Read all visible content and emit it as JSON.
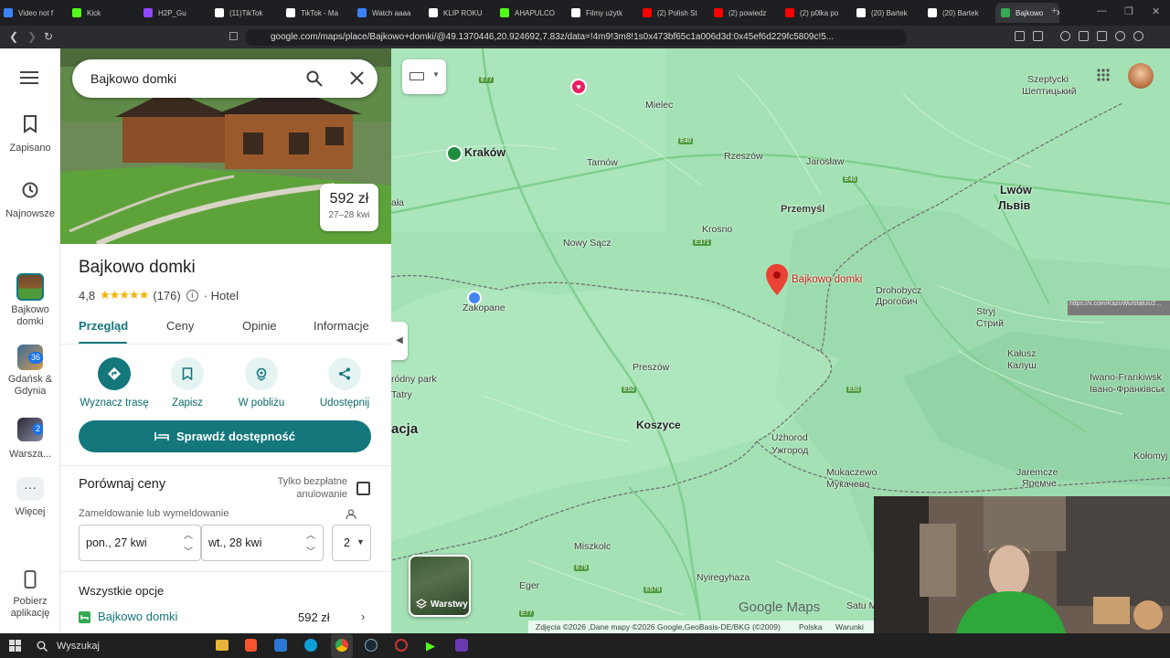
{
  "browser": {
    "tabs": [
      {
        "label": "Video not f",
        "icon": "video-icon",
        "color": "#3b82f6"
      },
      {
        "label": "Kick",
        "icon": "kick-icon",
        "color": "#53fc18"
      },
      {
        "label": "H2P_Gu",
        "icon": "twitch-icon",
        "color": "#9146ff"
      },
      {
        "label": "(11)TikTok",
        "icon": "tiktok-icon",
        "color": "#ffffff"
      },
      {
        "label": "TikTok - Ma",
        "icon": "tiktok-icon",
        "color": "#ffffff"
      },
      {
        "label": "Watch aaaa",
        "icon": "video-icon",
        "color": "#3b82f6"
      },
      {
        "label": "KLIP ROKU",
        "icon": "tiktok-icon",
        "color": "#ffffff"
      },
      {
        "label": "AHAPULCO",
        "icon": "kick-icon",
        "color": "#53fc18"
      },
      {
        "label": "Filmy użytk",
        "icon": "tiktok-icon",
        "color": "#ffffff"
      },
      {
        "label": "(2) Polish St",
        "icon": "youtube-icon",
        "color": "#ff0000"
      },
      {
        "label": "(2) powiedz",
        "icon": "youtube-icon",
        "color": "#ff0000"
      },
      {
        "label": "(2) p0lka po",
        "icon": "youtube-icon",
        "color": "#ff0000"
      },
      {
        "label": "(20) Bartek",
        "icon": "x-icon",
        "color": "#ffffff"
      },
      {
        "label": "(20) Bartek",
        "icon": "x-icon",
        "color": "#ffffff"
      },
      {
        "label": "Bajkowo",
        "icon": "maps-pin-icon",
        "color": "#34a853",
        "active": true
      }
    ],
    "url": "google.com/maps/place/Bajkowo+domki/@49.1370446,20.924692,7.83z/data=!4m9!3m8!1s0x473bf65c1a006d3d:0x45ef6d229fc5809c!5..."
  },
  "rail": {
    "menu_icon": "hamburger-menu-icon",
    "items": [
      {
        "label": "Zapisano",
        "icon": "bookmark-icon"
      },
      {
        "label": "Najnowsze",
        "icon": "history-icon"
      },
      {
        "label": "Bajkowo domki",
        "icon": "recent-place-thumbnail"
      },
      {
        "label": "Gdańsk & Gdynia",
        "icon": "recent-place-thumbnail",
        "badge": "36"
      },
      {
        "label": "Warsza...",
        "icon": "recent-place-thumbnail",
        "badge": "2"
      },
      {
        "label": "Więcej",
        "icon": "more-icon"
      },
      {
        "label": "Pobierz aplikację",
        "icon": "phone-icon"
      }
    ]
  },
  "panel": {
    "search_value": "Bajkowo domki",
    "hero_price": "592 zł",
    "hero_dates": "27–28 kwi",
    "title": "Bajkowo domki",
    "rating": "4,8",
    "stars": "★★★★★",
    "rating_value": 4.8,
    "reviews": "(176)",
    "category": "· Hotel",
    "tabs": [
      "Przegląd",
      "Ceny",
      "Opinie",
      "Informacje"
    ],
    "active_tab": "Przegląd",
    "actions": [
      {
        "label": "Wyznacz trasę",
        "icon": "directions-icon"
      },
      {
        "label": "Zapisz",
        "icon": "bookmark-icon"
      },
      {
        "label": "W pobliżu",
        "icon": "nearby-icon"
      },
      {
        "label": "Udostępnij",
        "icon": "share-icon"
      }
    ],
    "availability_button": "Sprawdź dostępność",
    "compare_title": "Porównaj ceny",
    "free_cancel_label_line1": "Tylko bezpłatne",
    "free_cancel_label_line2": "anulowanie",
    "checkin_label": "Zameldowanie lub wymeldowanie",
    "checkin": "pon., 27 kwi",
    "checkout": "wt., 28 kwi",
    "guests": "2",
    "all_options_title": "Wszystkie opcje",
    "option_name": "Bajkowo domki",
    "option_price": "592 zł"
  },
  "map": {
    "layers_label": "Warstwy",
    "pin_label": "Bajkowo domki",
    "cities": [
      {
        "name": "Kraków",
        "big": true
      },
      {
        "name": "Mielec"
      },
      {
        "name": "Tarnów"
      },
      {
        "name": "Rzeszów"
      },
      {
        "name": "Jarosław"
      },
      {
        "name": "Przemyśl",
        "big": true
      },
      {
        "name": "Krosno"
      },
      {
        "name": "Nowy Sącz"
      },
      {
        "name": "Zakopane"
      },
      {
        "name": "Lwów",
        "big": true
      },
      {
        "name": "Львів",
        "big": true
      },
      {
        "name": "Szeptycki"
      },
      {
        "name": "Шептицький"
      },
      {
        "name": "Drohobycz"
      },
      {
        "name": "Дрогобич"
      },
      {
        "name": "Stryj"
      },
      {
        "name": "Стрий"
      },
      {
        "name": "Kałusz"
      },
      {
        "name": "Калуш"
      },
      {
        "name": "Iwano-Frankiwsk"
      },
      {
        "name": "Івано-Франківськ"
      },
      {
        "name": "Preszów"
      },
      {
        "name": "Koszyce",
        "big": true
      },
      {
        "name": "Użhorod"
      },
      {
        "name": "Ужгород"
      },
      {
        "name": "Mukaczewo"
      },
      {
        "name": "Мукачево"
      },
      {
        "name": "Jaremcze"
      },
      {
        "name": "Яремче"
      },
      {
        "name": "Kołomyj"
      },
      {
        "name": "Miszkolc"
      },
      {
        "name": "Nyiregyhaza"
      },
      {
        "name": "Eger"
      },
      {
        "name": "Satu M"
      },
      {
        "name": "Tatry"
      },
      {
        "name": "ała"
      },
      {
        "name": "acja"
      },
      {
        "name": "ródny park"
      }
    ],
    "roads": [
      "E77",
      "E40",
      "E40",
      "E371",
      "E50",
      "E50",
      "E79",
      "E579",
      "E77"
    ],
    "logo": "Google Maps",
    "attribution": "Zdjęcia ©2026 ,Dane mapy ©2026 Google,GeoBasis-DE/BKG (©2009)",
    "country": "Polska",
    "terms": "Warunki",
    "tooltip": "https://x.com/KazuWu/status/2..."
  },
  "taskbar": {
    "search": "Wyszukaj"
  },
  "colors": {
    "teal": "#13777c",
    "map_green": "#a4e2b5",
    "pin": "#ea4335",
    "star": "#f4b400"
  }
}
